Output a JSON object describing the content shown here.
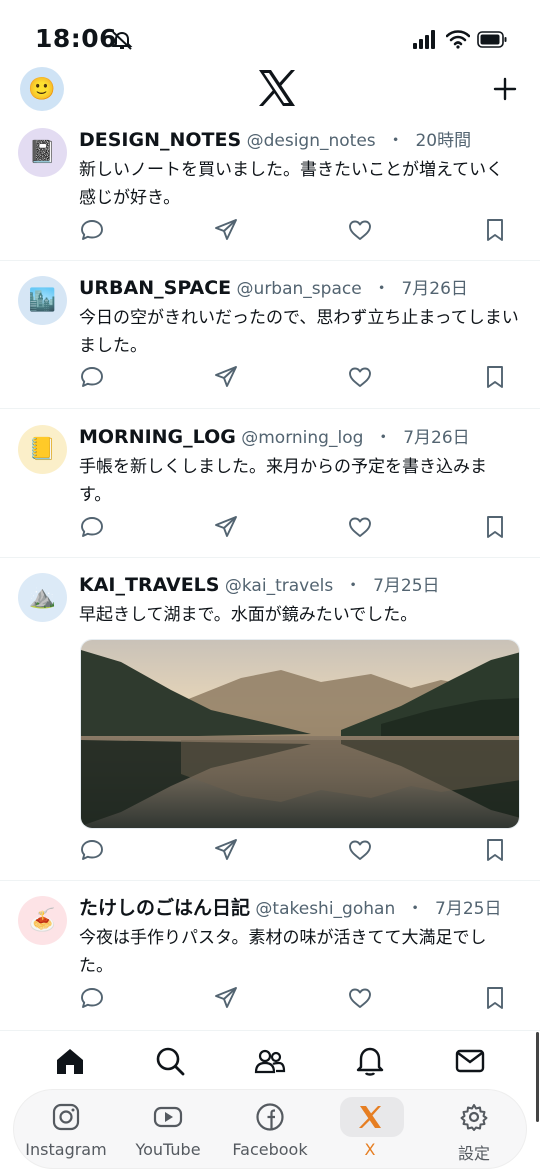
{
  "status_bar": {
    "time": "18:06"
  },
  "header": {
    "profile_avatar_emoji": "🙂"
  },
  "posts": [
    {
      "avatar_emoji": "📓",
      "avatar_bg": "#e3dcf2",
      "name": "DESIGN_NOTES",
      "handle": "@design_notes",
      "dot": "・",
      "time": "20時間",
      "text": "新しいノートを買いました。書きたいことが増えていく感じが好き。"
    },
    {
      "avatar_emoji": "🏙️",
      "avatar_bg": "#d6e6f5",
      "name": "URBAN_SPACE",
      "handle": "@urban_space",
      "dot": "・",
      "time": "7月26日",
      "text": "今日の空がきれいだったので、思わず立ち止まってしまいました。"
    },
    {
      "avatar_emoji": "📒",
      "avatar_bg": "#fbefc9",
      "name": "MORNING_LOG",
      "handle": "@morning_log",
      "dot": "・",
      "time": "7月26日",
      "text": "手帳を新しくしました。来月からの予定を書き込みます。"
    },
    {
      "avatar_emoji": "⛰️",
      "avatar_bg": "#dceaf7",
      "name": "KAI_TRAVELS",
      "handle": "@kai_travels",
      "dot": "・",
      "time": "7月25日",
      "text": "早起きして湖まで。水面が鏡みたいでした。"
    },
    {
      "avatar_emoji": "🍝",
      "avatar_bg": "#fde3e6",
      "name": "たけしのごはん日記",
      "handle": "@takeshi_gohan",
      "dot": "・",
      "time": "7月25日",
      "text": "今夜は手作りパスタ。素材の味が活きてて大満足でした。"
    }
  ],
  "dock": {
    "items": [
      {
        "label": "Instagram",
        "icon": "instagram-icon"
      },
      {
        "label": "YouTube",
        "icon": "youtube-icon"
      },
      {
        "label": "Facebook",
        "icon": "facebook-icon"
      },
      {
        "label": "X",
        "icon": "x-icon"
      },
      {
        "label": "設定",
        "icon": "settings-icon"
      }
    ],
    "active_color": "#e67e22"
  },
  "colors": {
    "text": "#0f1419",
    "muted": "#536471",
    "divider": "#eff3f4"
  }
}
